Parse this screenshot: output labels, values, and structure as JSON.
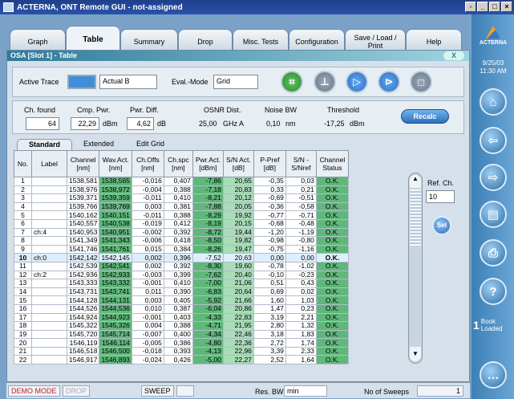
{
  "window": {
    "title": "ACTERNA, ONT Remote GUI - not-assigned"
  },
  "tabs": [
    {
      "label": "Graph"
    },
    {
      "label": "Table"
    },
    {
      "label": "Summary"
    },
    {
      "label": "Drop"
    },
    {
      "label": "Misc. Tests"
    },
    {
      "label": "Configuration"
    },
    {
      "label": "Save / Load / Print"
    },
    {
      "label": "Help"
    }
  ],
  "panel": {
    "title": "OSA [Slot 1] - Table",
    "close": "X"
  },
  "controls": {
    "active_trace_label": "Active Trace",
    "active_trace_value": "Actual B",
    "eval_mode_label": "Eval.-Mode",
    "eval_mode_value": "Grid"
  },
  "readouts": {
    "ch_found_label": "Ch. found",
    "ch_found_value": "64",
    "cmp_pwr_label": "Cmp. Pwr.",
    "cmp_pwr_value": "22,29",
    "cmp_pwr_unit": "dBm",
    "pwr_diff_label": "Pwr. Diff.",
    "pwr_diff_value": "4,62",
    "pwr_diff_unit": "dB",
    "osnr_label": "OSNR Dist.",
    "osnr_value": "25,00",
    "osnr_unit": "GHz A",
    "noise_bw_label": "Noise BW",
    "noise_bw_value": "0,10",
    "noise_bw_unit": "nm",
    "threshold_label": "Threshold",
    "threshold_value": "-17,25",
    "threshold_unit": "dBm",
    "recalc_label": "Recalc"
  },
  "subtabs": [
    "Standard",
    "Extended",
    "Edit Grid"
  ],
  "table": {
    "headers": [
      "No.",
      "Label",
      "Channel [nm]",
      "Wav.Act. [nm]",
      "Ch.Offs [nm]",
      "Ch.spc [nm]",
      "Pwr.Act. [dBm]",
      "S/N Act. [dB]",
      "P-Pref [dB]",
      "S/N - S/Nref",
      "Channel Status"
    ],
    "rows": [
      [
        "1",
        "",
        "1538,581",
        "1538,565",
        "-0,016",
        "0,407",
        "-7,86",
        "20,65",
        "-0,35",
        "0,03",
        "O.K."
      ],
      [
        "2",
        "",
        "1538,976",
        "1538,972",
        "-0,004",
        "0,388",
        "-7,18",
        "20,83",
        "0,33",
        "0,21",
        "O.K."
      ],
      [
        "3",
        "",
        "1539,371",
        "1539,359",
        "-0,011",
        "0,410",
        "-8,21",
        "20,12",
        "-0,69",
        "-0,51",
        "O.K."
      ],
      [
        "4",
        "",
        "1539,766",
        "1539,769",
        "0,003",
        "0,381",
        "-7,88",
        "20,05",
        "-0,36",
        "-0,58",
        "O.K."
      ],
      [
        "5",
        "",
        "1540,162",
        "1540,151",
        "-0,011",
        "0,388",
        "-8,29",
        "19,92",
        "-0,77",
        "-0,71",
        "O.K."
      ],
      [
        "6",
        "",
        "1540,557",
        "1540,538",
        "-0,019",
        "0,412",
        "-8,19",
        "20,15",
        "-0,68",
        "-0,48",
        "O.K."
      ],
      [
        "7",
        "ch:4",
        "1540,953",
        "1540,951",
        "-0,002",
        "0,392",
        "-8,72",
        "19,44",
        "-1,20",
        "-1,19",
        "O.K."
      ],
      [
        "8",
        "",
        "1541,349",
        "1541,343",
        "-0,006",
        "0,418",
        "-8,50",
        "19,82",
        "-0,98",
        "-0,80",
        "O.K."
      ],
      [
        "9",
        "",
        "1541,746",
        "1541,761",
        "0,015",
        "0,384",
        "-8,26",
        "19,47",
        "-0,75",
        "-1,16",
        "O.K."
      ],
      [
        "10",
        "ch:0",
        "1542,142",
        "1542,145",
        "0,002",
        "0,396",
        "-7,52",
        "20,63",
        "0,00",
        "0,00",
        "O.K."
      ],
      [
        "11",
        "",
        "1542,539",
        "1542,541",
        "0,002",
        "0,392",
        "-8,30",
        "19,60",
        "-0,78",
        "-1,02",
        "O.K."
      ],
      [
        "12",
        "ch:2",
        "1542,936",
        "1542,933",
        "-0,003",
        "0,399",
        "-7,62",
        "20,40",
        "-0,10",
        "-0,23",
        "O.K."
      ],
      [
        "13",
        "",
        "1543,333",
        "1543,332",
        "-0,001",
        "0,410",
        "-7,00",
        "21,06",
        "0,51",
        "0,43",
        "O.K."
      ],
      [
        "14",
        "",
        "1543,731",
        "1543,741",
        "0,011",
        "0,390",
        "-6,83",
        "20,64",
        "0,69",
        "0,02",
        "O.K."
      ],
      [
        "15",
        "",
        "1544,128",
        "1544,131",
        "0,003",
        "0,405",
        "-5,92",
        "21,66",
        "1,60",
        "1,03",
        "O.K."
      ],
      [
        "16",
        "",
        "1544,526",
        "1544,536",
        "0,010",
        "0,387",
        "-6,04",
        "20,86",
        "1,47",
        "0,23",
        "O.K."
      ],
      [
        "17",
        "",
        "1544,924",
        "1544,923",
        "-0,001",
        "0,403",
        "-4,33",
        "22,83",
        "3,19",
        "2,21",
        "O.K."
      ],
      [
        "18",
        "",
        "1545,322",
        "1545,326",
        "0,004",
        "0,388",
        "-4,71",
        "21,95",
        "2,80",
        "1,32",
        "O.K."
      ],
      [
        "19",
        "",
        "1545,720",
        "1545,714",
        "-0,007",
        "0,400",
        "-4,34",
        "22,46",
        "3,18",
        "1,83",
        "O.K."
      ],
      [
        "20",
        "",
        "1546,119",
        "1546,114",
        "-0,005",
        "0,386",
        "-4,80",
        "22,36",
        "2,72",
        "1,74",
        "O.K."
      ],
      [
        "21",
        "",
        "1546,518",
        "1546,500",
        "-0,018",
        "0,393",
        "-4,13",
        "22,96",
        "3,39",
        "2,33",
        "O.K."
      ],
      [
        "22",
        "",
        "1546,917",
        "1546,893",
        "-0,024",
        "0,426",
        "-5,00",
        "22,27",
        "2,52",
        "1,64",
        "O.K."
      ]
    ],
    "selected_row_index": 9
  },
  "ref": {
    "label": "Ref. Ch.",
    "value": "10",
    "set_label": "Set"
  },
  "sidebar": {
    "brand": "ACTERNA",
    "date": "9/25/03",
    "time": "11:30 AM",
    "book_count": "1",
    "book_label": "Book Loaded"
  },
  "status": {
    "demo_mode": "DEMO MODE",
    "drop": "DROP",
    "sweep": "SWEEP",
    "res_bw_label": "Res. BW",
    "res_bw_value": "min",
    "sweeps_label": "No of Sweeps",
    "sweeps_value": "1"
  },
  "colors": {
    "green": "#5fb87a",
    "light_green": "#a8ddb8",
    "selected": "#dfeefc",
    "demo_red": "#c02020"
  }
}
